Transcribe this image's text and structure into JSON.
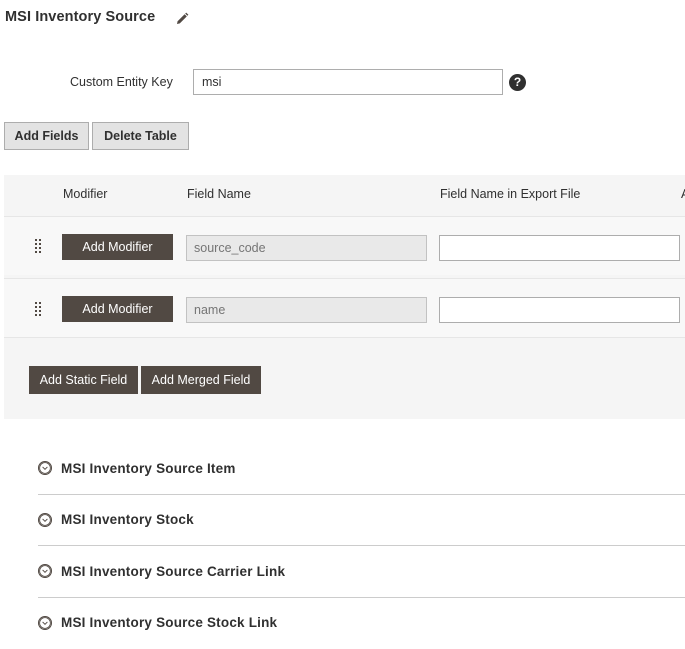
{
  "header": {
    "title": "MSI Inventory Source"
  },
  "custom_key": {
    "label": "Custom Entity Key",
    "value": "msi",
    "help": "?"
  },
  "actions": {
    "add_fields": "Add Fields",
    "delete_table": "Delete Table"
  },
  "table": {
    "columns": [
      "Modifier",
      "Field Name",
      "Field Name in Export File",
      "A"
    ],
    "rows": [
      {
        "modifier_button": "Add Modifier",
        "field_placeholder": "source_code",
        "export_value": ""
      },
      {
        "modifier_button": "Add Modifier",
        "field_placeholder": "name",
        "export_value": ""
      }
    ],
    "add_static": "Add Static Field",
    "add_merged": "Add Merged Field"
  },
  "sections": [
    {
      "title": "MSI Inventory Source Item"
    },
    {
      "title": "MSI Inventory Stock"
    },
    {
      "title": "MSI Inventory Source Carrier Link"
    },
    {
      "title": "MSI Inventory Source Stock Link"
    }
  ],
  "colors": {
    "dark_button": "#514943",
    "light_button": "#e3e3e3",
    "text": "#303030"
  }
}
